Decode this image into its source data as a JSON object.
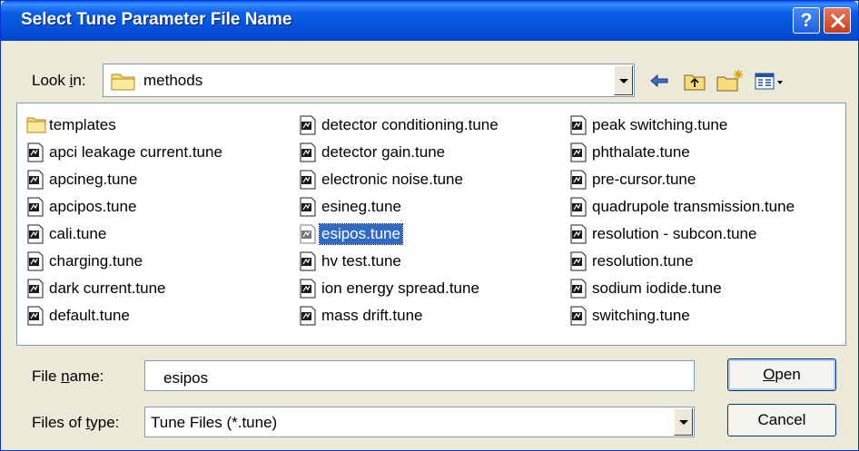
{
  "window": {
    "title": "Select Tune Parameter File Name",
    "help_label": "?"
  },
  "lookin": {
    "label_prefix": "Look ",
    "label_accel": "i",
    "label_suffix": "n:",
    "value": "methods"
  },
  "files": {
    "columns": [
      [
        {
          "name": "templates",
          "type": "folder"
        },
        {
          "name": "apci leakage current.tune",
          "type": "tune"
        },
        {
          "name": "apcineg.tune",
          "type": "tune"
        },
        {
          "name": "apcipos.tune",
          "type": "tune"
        },
        {
          "name": "cali.tune",
          "type": "tune"
        },
        {
          "name": "charging.tune",
          "type": "tune"
        },
        {
          "name": "dark current.tune",
          "type": "tune"
        },
        {
          "name": "default.tune",
          "type": "tune"
        }
      ],
      [
        {
          "name": "detector conditioning.tune",
          "type": "tune"
        },
        {
          "name": "detector gain.tune",
          "type": "tune"
        },
        {
          "name": "electronic noise.tune",
          "type": "tune"
        },
        {
          "name": "esineg.tune",
          "type": "tune"
        },
        {
          "name": "esipos.tune",
          "type": "tune",
          "selected": true
        },
        {
          "name": "hv test.tune",
          "type": "tune"
        },
        {
          "name": "ion energy spread.tune",
          "type": "tune"
        },
        {
          "name": "mass drift.tune",
          "type": "tune"
        }
      ],
      [
        {
          "name": "peak switching.tune",
          "type": "tune"
        },
        {
          "name": "phthalate.tune",
          "type": "tune"
        },
        {
          "name": "pre-cursor.tune",
          "type": "tune"
        },
        {
          "name": "quadrupole transmission.tune",
          "type": "tune"
        },
        {
          "name": "resolution - subcon.tune",
          "type": "tune"
        },
        {
          "name": "resolution.tune",
          "type": "tune"
        },
        {
          "name": "sodium iodide.tune",
          "type": "tune"
        },
        {
          "name": "switching.tune",
          "type": "tune"
        }
      ]
    ]
  },
  "filename": {
    "label_prefix": "File ",
    "label_accel": "n",
    "label_suffix": "ame:",
    "value": "esipos"
  },
  "filetype": {
    "label_prefix": "Files of ",
    "label_accel": "t",
    "label_suffix": "ype:",
    "value": "Tune Files (*.tune)"
  },
  "buttons": {
    "open_accel": "O",
    "open_rest": "pen",
    "cancel": "Cancel"
  },
  "colors": {
    "titlebar": "#0a5ae8",
    "selection": "#316ac5",
    "dialog_bg": "#ece9d8"
  }
}
